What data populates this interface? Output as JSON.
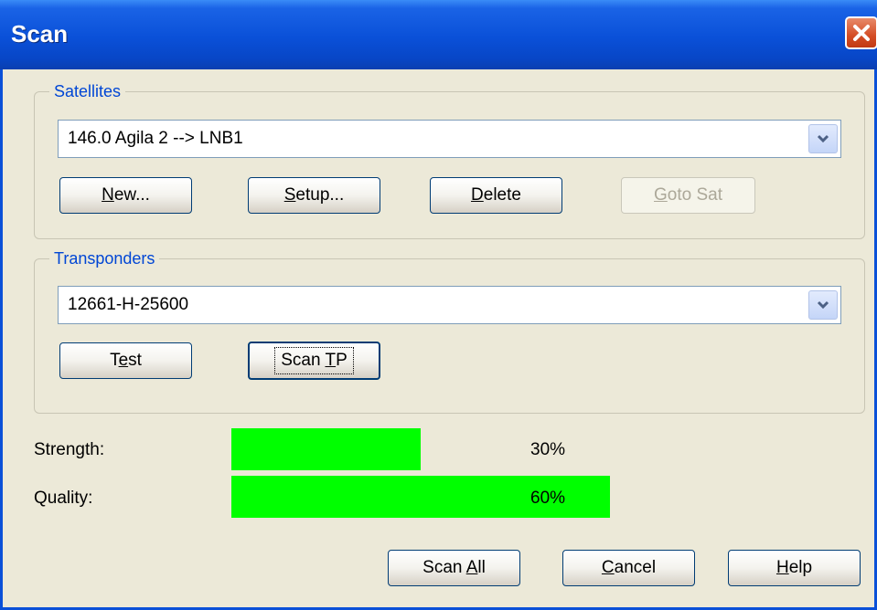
{
  "window": {
    "title": "Scan"
  },
  "satellites": {
    "group_label": "Satellites",
    "selected": "146.0 Agila 2 --> LNB1",
    "buttons": {
      "new": {
        "mnemonic": "N",
        "rest": "ew..."
      },
      "setup": {
        "mnemonic": "S",
        "rest": "etup..."
      },
      "delete": {
        "mnemonic": "D",
        "rest": "elete"
      },
      "goto_sat": {
        "mnemonic": "G",
        "rest": "oto Sat",
        "disabled": true
      }
    }
  },
  "transponders": {
    "group_label": "Transponders",
    "selected": "12661-H-25600",
    "buttons": {
      "test": {
        "pre": "T",
        "mnemonic": "e",
        "rest": "st"
      },
      "scan_tp": {
        "pre": "Scan ",
        "mnemonic": "T",
        "rest": "P",
        "focused": true
      }
    }
  },
  "signal": {
    "strength": {
      "label": "Strength:",
      "value_text": "30%",
      "level": 0.3,
      "color": "#00ff00"
    },
    "quality": {
      "label": "Quality:",
      "value_text": "60%",
      "level": 0.6,
      "color": "#00ff00"
    }
  },
  "footer": {
    "scan_all": {
      "pre": "Scan ",
      "mnemonic": "A",
      "rest": "ll"
    },
    "cancel": {
      "mnemonic": "C",
      "rest": "ancel"
    },
    "help": {
      "mnemonic": "H",
      "rest": "elp"
    }
  },
  "icons": {
    "close": "close-icon",
    "dropdown": "chevron-down-icon"
  },
  "colors": {
    "titlebar": "#0a50d8",
    "group_label": "#0046d5",
    "close_button": "#d44d25",
    "bar": "#00ff00"
  }
}
